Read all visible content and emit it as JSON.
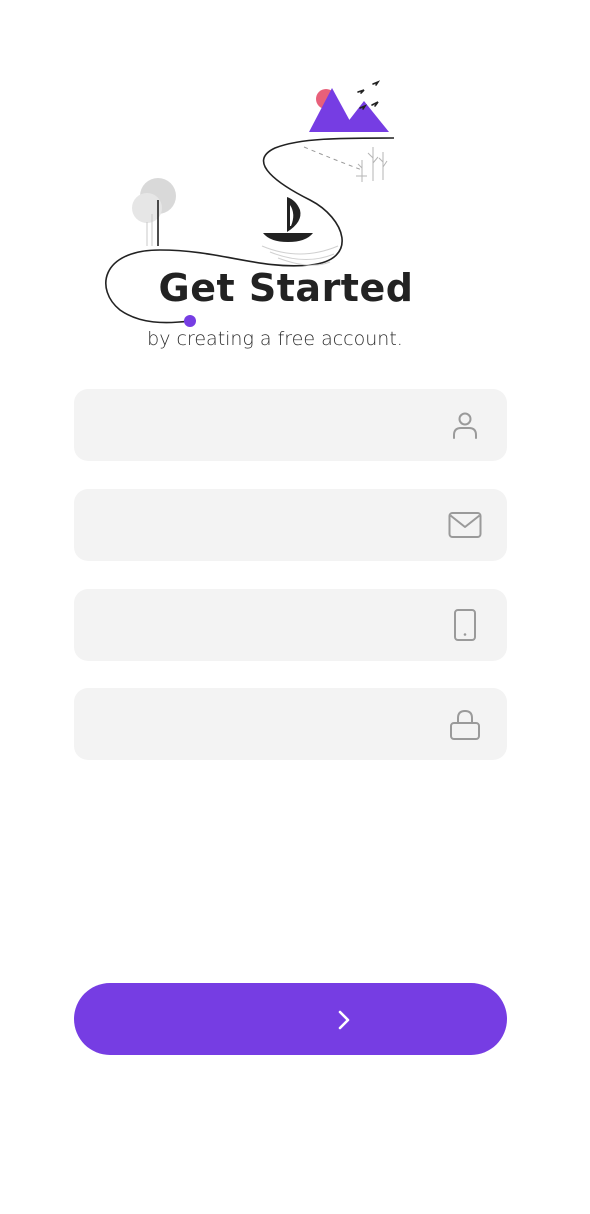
{
  "header": {
    "title": "Get Started",
    "subtitle": "by creating a free account."
  },
  "form": {
    "fields": [
      {
        "name": "name",
        "value": "",
        "placeholder": "",
        "icon": "person-icon"
      },
      {
        "name": "email",
        "value": "",
        "placeholder": "",
        "icon": "mail-icon"
      },
      {
        "name": "phone",
        "value": "",
        "placeholder": "",
        "icon": "phone-icon"
      },
      {
        "name": "password",
        "value": "",
        "placeholder": "",
        "icon": "lock-icon"
      }
    ],
    "submit_icon": "chevron-right-icon"
  },
  "colors": {
    "accent": "#763de3",
    "field_background": "#f3f3f3",
    "icon_gray": "#9a9a9a",
    "title_text": "#222222",
    "sun_pink": "#e8607a"
  }
}
